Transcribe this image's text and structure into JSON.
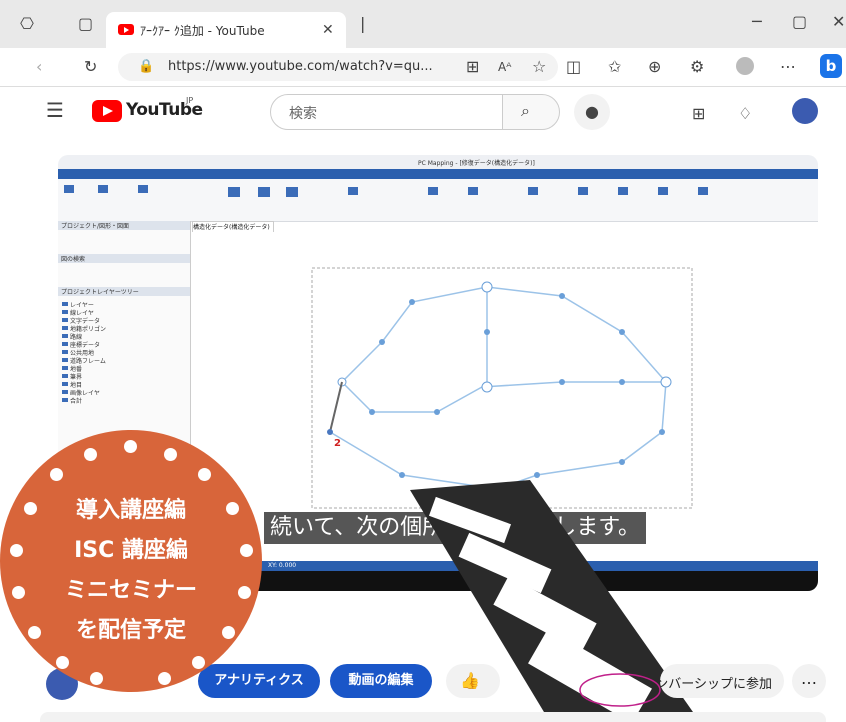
{
  "browser": {
    "tab_title": "ｱｰｸｱｰ ｸ追加 - YouTube",
    "new_tab": "+",
    "address": "https://www.youtube.com/watch?v=qu...",
    "icons": [
      "workspaces-icon",
      "tab-actions-icon",
      "back-icon",
      "refresh-icon",
      "lock-icon",
      "app-available-icon",
      "read-aloud-icon",
      "favorite-star-icon",
      "split-screen-icon",
      "favorites-icon",
      "collections-icon",
      "extensions-icon",
      "profile-icon",
      "more-icon",
      "bing-icon",
      "minimize-icon",
      "maximize-icon",
      "close-icon"
    ]
  },
  "youtube": {
    "logo_text": "YouTube",
    "region": "JP",
    "search_placeholder": "検索"
  },
  "video": {
    "window_title": "PC Mapping - [修復データ(構造化データ)]",
    "doc_tab": "構造化データ(構造化データ)",
    "panel_layers": "プロジェクト/図形・図面",
    "panel_search": "図の検索",
    "panel_tree": "プロジェクトレイヤーツリー",
    "tree_items": [
      "レイヤー",
      "線レイヤ",
      "文字データ",
      "地籍ポリゴン",
      "路線",
      "座標データ",
      "公共用地",
      "道路フレーム",
      "地番",
      "筆界",
      "地目",
      "画像レイヤ",
      "合計"
    ],
    "caption": "続いて、次の個所をクリックします。",
    "status_left": "XY: 0.000",
    "point_label": "2"
  },
  "actions": {
    "analytics": "アナリティクス",
    "edit_video": "動画の編集",
    "join": "メンバーシップに参加",
    "more": "…"
  },
  "promo": {
    "lines": [
      "導入講座編",
      "ISC 講座編",
      "ミニセミナー",
      "を配信予定"
    ],
    "color": "#d8653a"
  },
  "colors": {
    "youtube_red": "#ff0000",
    "action_blue": "#1a56c8",
    "ribbon_blue": "#2b5fae",
    "graph_line": "#9cc3e8",
    "graph_node": "#6a9fd8"
  }
}
